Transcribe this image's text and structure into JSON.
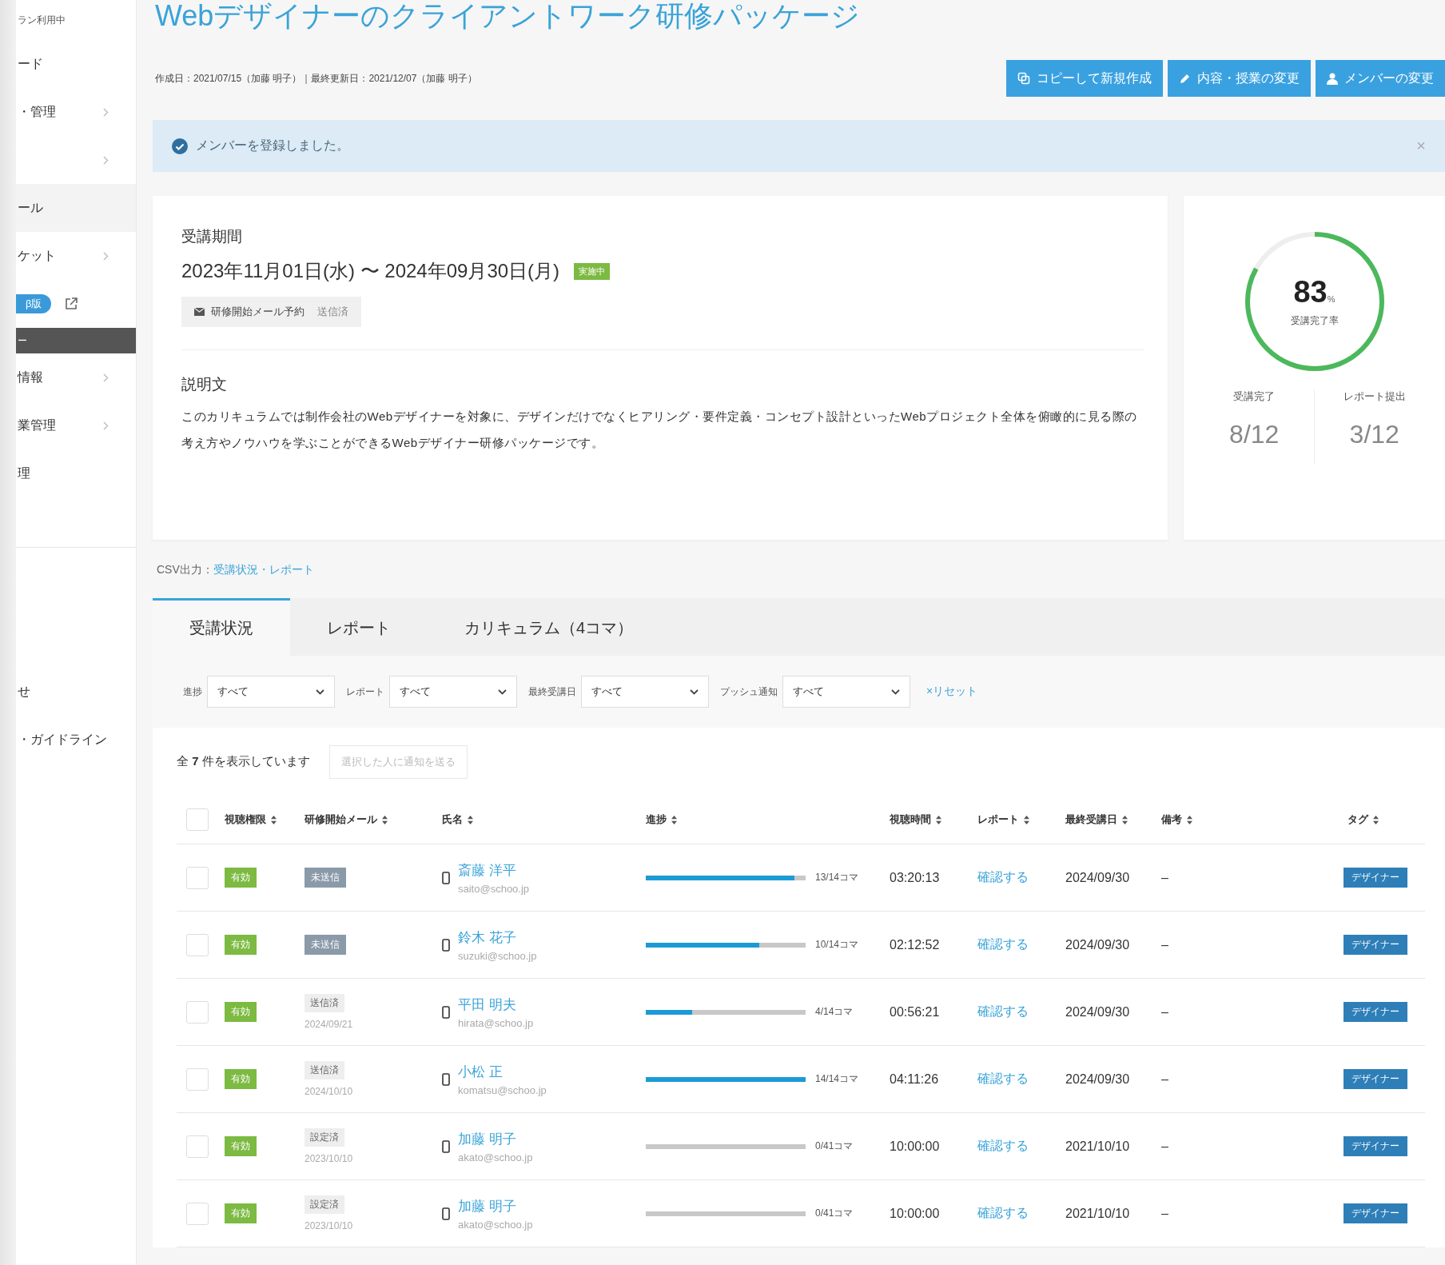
{
  "sidebar": {
    "plan_status": "ラン利用中",
    "items": [
      {
        "label": "ード",
        "has_submenu": false,
        "selected": false,
        "kind": "link"
      },
      {
        "label": "・管理",
        "has_submenu": true,
        "selected": false,
        "kind": "link"
      },
      {
        "has_submenu": true,
        "selected": false,
        "kind": "link"
      },
      {
        "label": "ール",
        "has_submenu": false,
        "selected": true,
        "kind": "link"
      },
      {
        "label": "ケット",
        "has_submenu": true,
        "selected": false,
        "kind": "link"
      },
      {
        "label": "β版",
        "kind": "beta"
      },
      {
        "label": "ー",
        "kind": "section"
      },
      {
        "label": "情報",
        "has_submenu": true,
        "selected": false,
        "kind": "link"
      },
      {
        "label": "業管理",
        "has_submenu": true,
        "selected": false,
        "kind": "link"
      },
      {
        "label": "理",
        "has_submenu": false,
        "selected": false,
        "kind": "link"
      }
    ],
    "footer_items": [
      {
        "label": "せ"
      },
      {
        "label": "・ガイドライン"
      }
    ]
  },
  "page": {
    "title": "Webデザイナーのクライアントワーク研修パッケージ",
    "meta": "作成日：2021/07/15（加藤 明子）｜最終更新日：2021/12/07（加藤 明子）",
    "buttons": [
      {
        "label": "コピーして新規作成"
      },
      {
        "label": "内容・授業の変更"
      },
      {
        "label": "メンバーの変更"
      }
    ]
  },
  "alert": {
    "message": "メンバーを登録しました。",
    "close": "×"
  },
  "period": {
    "heading": "受講期間",
    "range": "2023年11月01日(水) 〜 2024年09月30日(月)",
    "status": "実施中",
    "mail_label": "研修開始メール予約",
    "mail_status": "送信済"
  },
  "description": {
    "heading": "説明文",
    "text": "このカリキュラムでは制作会社のWebデザイナーを対象に、デザインだけでなくヒアリング・要件定義・コンセプト設計といったWebプロジェクト全体を俯瞰的に見る際の考え方やノウハウを学ぶことができるWebデザイナー研修パッケージです。"
  },
  "summary": {
    "rate": "83",
    "unit": "%",
    "rate_label": "受講完了率",
    "level": 0.83,
    "stats": [
      {
        "label": "受講完了",
        "value": "8/12"
      },
      {
        "label": "レポート提出",
        "value": "3/12"
      }
    ]
  },
  "csv": {
    "label": "CSV出力：",
    "link": "受講状況・レポート"
  },
  "tabs": [
    {
      "label": "受講状況",
      "selected": true
    },
    {
      "label": "レポート",
      "selected": false
    },
    {
      "label": "カリキュラム（4コマ）",
      "selected": false
    }
  ],
  "filters": [
    {
      "label": "進捗",
      "value": "すべて"
    },
    {
      "label": "レポート",
      "value": "すべて"
    },
    {
      "label": "最終受講日",
      "value": "すべて"
    },
    {
      "label": "プッシュ通知",
      "value": "すべて"
    }
  ],
  "reset": "×リセット",
  "count": "全 **7** 件を表示しています",
  "notify_button": {
    "label": "選択した人に通知を送る",
    "disabled": true
  },
  "table": {
    "all_checked": false,
    "columns": [
      "視聴権限",
      "研修開始メール",
      "氏名",
      "進捗",
      "視聴時間",
      "レポート",
      "最終受講日",
      "備考",
      "タグ"
    ],
    "rows": [
      {
        "checked": false,
        "access": "有効",
        "mail": {
          "kind": "unsent",
          "label": "未送信"
        },
        "name": "斎藤 洋平",
        "email": "saito@schoo.jp",
        "level": 0.93,
        "progress": "13/14コマ",
        "time": "03:20:13",
        "report": "確認する",
        "last": "2024/09/30",
        "note": "–",
        "tag": "デザイナー"
      },
      {
        "checked": false,
        "access": "有効",
        "mail": {
          "kind": "unsent",
          "label": "未送信"
        },
        "name": "鈴木 花子",
        "email": "suzuki@schoo.jp",
        "level": 0.71,
        "progress": "10/14コマ",
        "time": "02:12:52",
        "report": "確認する",
        "last": "2024/09/30",
        "note": "–",
        "tag": "デザイナー"
      },
      {
        "checked": false,
        "access": "有効",
        "mail": {
          "kind": "done",
          "label": "送信済",
          "date": "2024/09/21"
        },
        "name": "平田 明夫",
        "email": "hirata@schoo.jp",
        "level": 0.29,
        "progress": "4/14コマ",
        "time": "00:56:21",
        "report": "確認する",
        "last": "2024/09/30",
        "note": "–",
        "tag": "デザイナー"
      },
      {
        "checked": false,
        "access": "有効",
        "mail": {
          "kind": "done",
          "label": "送信済",
          "date": "2024/10/10"
        },
        "name": "小松 正",
        "email": "komatsu@schoo.jp",
        "level": 1,
        "progress": "14/14コマ",
        "time": "04:11:26",
        "report": "確認する",
        "last": "2024/09/30",
        "note": "–",
        "tag": "デザイナー"
      },
      {
        "checked": false,
        "access": "有効",
        "mail": {
          "kind": "done",
          "label": "設定済",
          "date": "2023/10/10"
        },
        "name": "加藤 明子",
        "email": "akato@schoo.jp",
        "level": 0,
        "progress": "0/41コマ",
        "time": "10:00:00",
        "report": "確認する",
        "last": "2021/10/10",
        "note": "–",
        "tag": "デザイナー"
      },
      {
        "checked": false,
        "access": "有効",
        "mail": {
          "kind": "done",
          "label": "設定済",
          "date": "2023/10/10"
        },
        "name": "加藤 明子",
        "email": "akato@schoo.jp",
        "level": 0,
        "progress": "0/41コマ",
        "time": "10:00:00",
        "report": "確認する",
        "last": "2021/10/10",
        "note": "–",
        "tag": "デザイナー"
      }
    ]
  }
}
